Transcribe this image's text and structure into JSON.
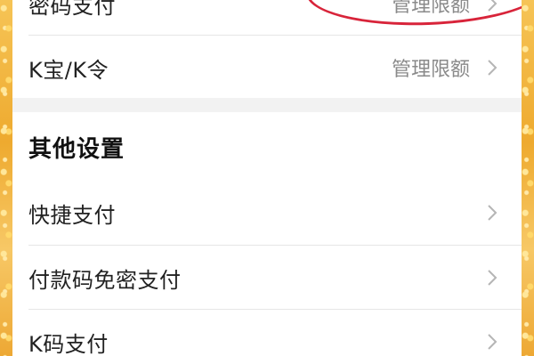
{
  "payment_rows": [
    {
      "label": "密码支付",
      "value": "管理限额"
    },
    {
      "label": "K宝/K令",
      "value": "管理限额"
    }
  ],
  "other_settings": {
    "title": "其他设置",
    "items": [
      {
        "label": "快捷支付"
      },
      {
        "label": "付款码免密支付"
      },
      {
        "label": "K码支付"
      }
    ]
  },
  "icons": {
    "chevron": "chevron-right-icon"
  },
  "colors": {
    "annotation_circle": "#d8243a",
    "background_frame": "#f3b23c",
    "secondary_text": "#8a8a8a"
  }
}
